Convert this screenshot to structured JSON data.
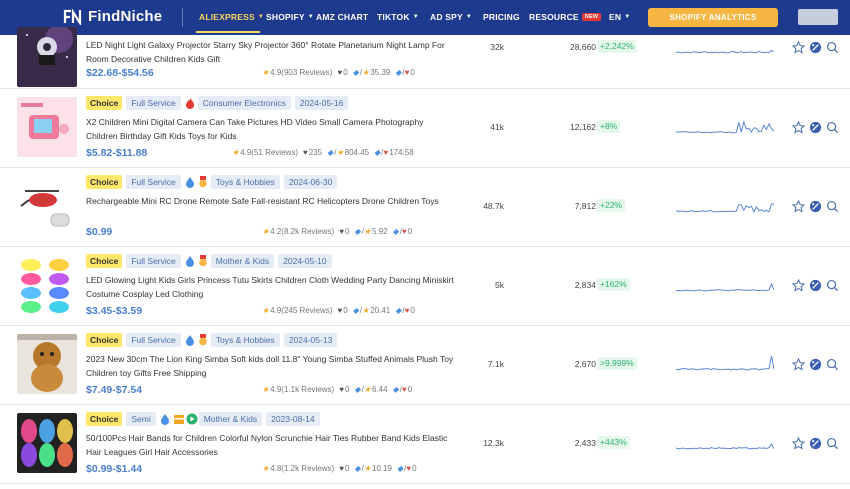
{
  "nav": {
    "logo": "FindNiche",
    "items": [
      {
        "label": "ALIEXPRESS",
        "caret": true,
        "active": true
      },
      {
        "label": "SHOPIFY",
        "caret": true
      },
      {
        "label": "AMZ CHART"
      },
      {
        "label": "TIKTOK",
        "caret": true
      },
      {
        "label": "AD SPY",
        "caret": true
      },
      {
        "label": "PRICING"
      },
      {
        "label": "RESOURCE",
        "badge": "NEW"
      },
      {
        "label": "EN",
        "caret": true
      }
    ],
    "cta": "SHOPIFY ANALYTICS"
  },
  "colors": {
    "nav_bg": "#1d3a8f",
    "accent": "#ffd65c",
    "price": "#4a7fd0",
    "growth": "#2bb36d",
    "spark": "#5a86d6"
  },
  "rows": [
    {
      "tags": [],
      "title": "LED Night Light Galaxy Projector Starry Sky Projector 360° Rotate Planetarium Night Lamp For Room Decorative Children Kids Gift",
      "price": "$22.68-$54.56",
      "rating": "4.9",
      "reviews": "(903 Reviews)",
      "wish": "0",
      "tag_score": "35.39",
      "tag_heart": "0",
      "sales": "32k",
      "count": "28,660",
      "growth": "+2,242%",
      "thumb": "projector"
    },
    {
      "tags": [
        {
          "text": "Choice",
          "kind": "choice"
        },
        {
          "text": "Full Service"
        },
        {
          "icon": "fire-icon"
        },
        {
          "text": "Consumer Electronics"
        },
        {
          "text": "2024-05-16"
        }
      ],
      "title": "X2 Children Mini Digital Camera Can Take Pictures HD Video Small Camera Photography Children Birthday Gift Kids Toys for Kids",
      "price": "$5.82-$11.88",
      "rating": "4.9",
      "reviews": "(51 Reviews)",
      "wish": "235",
      "tag_score": "804.45",
      "tag_heart": "174.58",
      "sales": "41k",
      "count": "12,162",
      "growth": "+8%",
      "thumb": "camera"
    },
    {
      "tags": [
        {
          "text": "Choice",
          "kind": "choice"
        },
        {
          "text": "Full Service"
        },
        {
          "icon": "drop-icon"
        },
        {
          "icon": "medal-icon"
        },
        {
          "text": "Toys & Hobbies"
        },
        {
          "text": "2024-06-30"
        }
      ],
      "title": "Rechargeable Mini RC Drone Remote Safe Fall-resistant RC Helicopters Drone Children Toys",
      "price": "$0.99",
      "rating": "4.2",
      "reviews": "(8.2k Reviews)",
      "wish": "0",
      "tag_score": "5.92",
      "tag_heart": "0",
      "sales": "48.7k",
      "count": "7,812",
      "growth": "+22%",
      "thumb": "drone"
    },
    {
      "tags": [
        {
          "text": "Choice",
          "kind": "choice"
        },
        {
          "text": "Full Service"
        },
        {
          "icon": "drop-icon"
        },
        {
          "icon": "medal-icon"
        },
        {
          "text": "Mother & Kids"
        },
        {
          "text": "2024-05-10"
        }
      ],
      "title": "LED Glowing Light Kids Girls Princess Tutu Skirts Children Cloth Wedding Party Dancing Miniskirt Costume Cosplay Led Clothing",
      "price": "$3.45-$3.59",
      "rating": "4.9",
      "reviews": "(245 Reviews)",
      "wish": "0",
      "tag_score": "20.41",
      "tag_heart": "0",
      "sales": "5k",
      "count": "2,834",
      "growth": "+162%",
      "thumb": "tutu"
    },
    {
      "tags": [
        {
          "text": "Choice",
          "kind": "choice"
        },
        {
          "text": "Full Service"
        },
        {
          "icon": "drop-icon"
        },
        {
          "icon": "medal-icon"
        },
        {
          "text": "Toys & Hobbies"
        },
        {
          "text": "2024-05-13"
        }
      ],
      "title": "2023 New 30cm The Lion King Simba Soft kids doll 11.8\" Young Simba Stuffed Animals Plush Toy Children toy Gifts Free Shipping",
      "price": "$7.49-$7.54",
      "rating": "4.9",
      "reviews": "(1.1k Reviews)",
      "wish": "0",
      "tag_score": "6.44",
      "tag_heart": "0",
      "sales": "7.1k",
      "count": "2,670",
      "growth": ">9,999%",
      "thumb": "simba"
    },
    {
      "tags": [
        {
          "text": "Choice",
          "kind": "choice"
        },
        {
          "text": "Semi"
        },
        {
          "icon": "drop-icon"
        },
        {
          "icon": "box-icon"
        },
        {
          "icon": "play-icon"
        },
        {
          "text": "Mother & Kids"
        },
        {
          "text": "2023-08-14"
        }
      ],
      "title": "50/100Pcs Hair Bands for Children Colorful Nylon Scrunchie Hair Ties Rubber Band Kids Elastic Hair Leagues Girl Hair Accessories",
      "price": "$0.99-$1.44",
      "rating": "4.8",
      "reviews": "(1.2k Reviews)",
      "wish": "0",
      "tag_score": "10.19",
      "tag_heart": "0",
      "sales": "12.3k",
      "count": "2,433",
      "growth": "+443%",
      "thumb": "hairbands"
    }
  ]
}
